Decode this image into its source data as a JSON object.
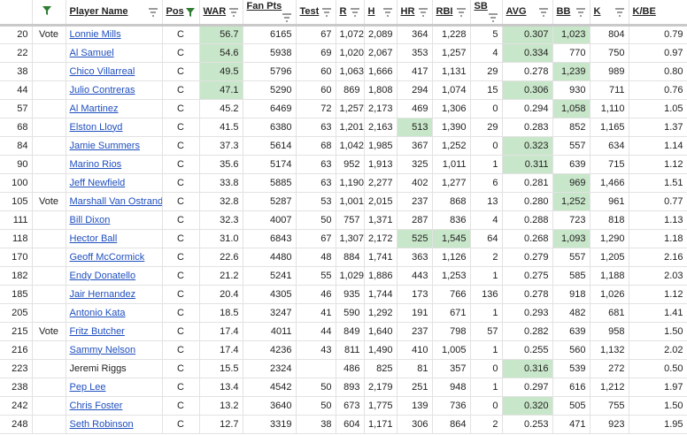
{
  "colors": {
    "highlight": "#c8e6c9",
    "link": "#1f4fbf",
    "filter_active": "#2e7d32",
    "filter_idle": "#7a7a7a"
  },
  "headers": {
    "blank1": "",
    "blank2": "",
    "player": "Player Name",
    "pos": "Pos",
    "war": "WAR",
    "fan": "Fan Pts",
    "test": "Test",
    "r": "R",
    "h": "H",
    "hr": "HR",
    "rbi": "RBI",
    "sb": "SB",
    "avg": "AVG",
    "bb": "BB",
    "k": "K",
    "kbb": "K/BE"
  },
  "rows": [
    {
      "num": "20",
      "vote": "Vote",
      "name": "Lonnie Mills",
      "link": true,
      "pos": "C",
      "war": "56.7",
      "fan": "6165",
      "test": "67",
      "r": "1,072",
      "h": "2,089",
      "hr": "364",
      "rbi": "1,228",
      "sb": "5",
      "avg": "0.307",
      "bb": "1,023",
      "k": "804",
      "kbb": "0.79",
      "hl": [
        "war",
        "avg",
        "bb"
      ]
    },
    {
      "num": "22",
      "vote": "",
      "name": "Al Samuel",
      "link": true,
      "pos": "C",
      "war": "54.6",
      "fan": "5938",
      "test": "69",
      "r": "1,020",
      "h": "2,067",
      "hr": "353",
      "rbi": "1,257",
      "sb": "4",
      "avg": "0.334",
      "bb": "770",
      "k": "750",
      "kbb": "0.97",
      "hl": [
        "war",
        "avg"
      ]
    },
    {
      "num": "38",
      "vote": "",
      "name": "Chico Villarreal",
      "link": true,
      "pos": "C",
      "war": "49.5",
      "fan": "5796",
      "test": "60",
      "r": "1,063",
      "h": "1,666",
      "hr": "417",
      "rbi": "1,131",
      "sb": "29",
      "avg": "0.278",
      "bb": "1,239",
      "k": "989",
      "kbb": "0.80",
      "hl": [
        "war",
        "bb"
      ]
    },
    {
      "num": "44",
      "vote": "",
      "name": "Julio Contreras",
      "link": true,
      "pos": "C",
      "war": "47.1",
      "fan": "5290",
      "test": "60",
      "r": "869",
      "h": "1,808",
      "hr": "294",
      "rbi": "1,074",
      "sb": "15",
      "avg": "0.306",
      "bb": "930",
      "k": "711",
      "kbb": "0.76",
      "hl": [
        "war",
        "avg"
      ]
    },
    {
      "num": "57",
      "vote": "",
      "name": "Al Martinez",
      "link": true,
      "pos": "C",
      "war": "45.2",
      "fan": "6469",
      "test": "72",
      "r": "1,257",
      "h": "2,173",
      "hr": "469",
      "rbi": "1,306",
      "sb": "0",
      "avg": "0.294",
      "bb": "1,058",
      "k": "1,110",
      "kbb": "1.05",
      "hl": [
        "bb"
      ]
    },
    {
      "num": "68",
      "vote": "",
      "name": "Elston Lloyd",
      "link": true,
      "pos": "C",
      "war": "41.5",
      "fan": "6380",
      "test": "63",
      "r": "1,201",
      "h": "2,163",
      "hr": "513",
      "rbi": "1,390",
      "sb": "29",
      "avg": "0.283",
      "bb": "852",
      "k": "1,165",
      "kbb": "1.37",
      "hl": [
        "hr"
      ]
    },
    {
      "num": "84",
      "vote": "",
      "name": "Jamie Summers",
      "link": true,
      "pos": "C",
      "war": "37.3",
      "fan": "5614",
      "test": "68",
      "r": "1,042",
      "h": "1,985",
      "hr": "367",
      "rbi": "1,252",
      "sb": "0",
      "avg": "0.323",
      "bb": "557",
      "k": "634",
      "kbb": "1.14",
      "hl": [
        "avg"
      ]
    },
    {
      "num": "90",
      "vote": "",
      "name": "Marino Rios",
      "link": true,
      "pos": "C",
      "war": "35.6",
      "fan": "5174",
      "test": "63",
      "r": "952",
      "h": "1,913",
      "hr": "325",
      "rbi": "1,011",
      "sb": "1",
      "avg": "0.311",
      "bb": "639",
      "k": "715",
      "kbb": "1.12",
      "hl": [
        "avg"
      ]
    },
    {
      "num": "100",
      "vote": "",
      "name": "Jeff Newfield",
      "link": true,
      "pos": "C",
      "war": "33.8",
      "fan": "5885",
      "test": "63",
      "r": "1,190",
      "h": "2,277",
      "hr": "402",
      "rbi": "1,277",
      "sb": "6",
      "avg": "0.281",
      "bb": "969",
      "k": "1,466",
      "kbb": "1.51",
      "hl": [
        "bb"
      ]
    },
    {
      "num": "105",
      "vote": "Vote",
      "name": "Marshall Van Ostrand",
      "link": true,
      "pos": "C",
      "war": "32.8",
      "fan": "5287",
      "test": "53",
      "r": "1,001",
      "h": "2,015",
      "hr": "237",
      "rbi": "868",
      "sb": "13",
      "avg": "0.280",
      "bb": "1,252",
      "k": "961",
      "kbb": "0.77",
      "hl": [
        "bb"
      ]
    },
    {
      "num": "111",
      "vote": "",
      "name": "Bill Dixon",
      "link": true,
      "pos": "C",
      "war": "32.3",
      "fan": "4007",
      "test": "50",
      "r": "757",
      "h": "1,371",
      "hr": "287",
      "rbi": "836",
      "sb": "4",
      "avg": "0.288",
      "bb": "723",
      "k": "818",
      "kbb": "1.13",
      "hl": []
    },
    {
      "num": "118",
      "vote": "",
      "name": "Hector Ball",
      "link": true,
      "pos": "C",
      "war": "31.0",
      "fan": "6843",
      "test": "67",
      "r": "1,307",
      "h": "2,172",
      "hr": "525",
      "rbi": "1,545",
      "sb": "64",
      "avg": "0.268",
      "bb": "1,093",
      "k": "1,290",
      "kbb": "1.18",
      "hl": [
        "hr",
        "rbi",
        "bb"
      ]
    },
    {
      "num": "170",
      "vote": "",
      "name": "Geoff McCormick",
      "link": true,
      "pos": "C",
      "war": "22.6",
      "fan": "4480",
      "test": "48",
      "r": "884",
      "h": "1,741",
      "hr": "363",
      "rbi": "1,126",
      "sb": "2",
      "avg": "0.279",
      "bb": "557",
      "k": "1,205",
      "kbb": "2.16",
      "hl": []
    },
    {
      "num": "182",
      "vote": "",
      "name": "Endy Donatello",
      "link": true,
      "pos": "C",
      "war": "21.2",
      "fan": "5241",
      "test": "55",
      "r": "1,029",
      "h": "1,886",
      "hr": "443",
      "rbi": "1,253",
      "sb": "1",
      "avg": "0.275",
      "bb": "585",
      "k": "1,188",
      "kbb": "2.03",
      "hl": []
    },
    {
      "num": "185",
      "vote": "",
      "name": "Jair Hernandez",
      "link": true,
      "pos": "C",
      "war": "20.4",
      "fan": "4305",
      "test": "46",
      "r": "935",
      "h": "1,744",
      "hr": "173",
      "rbi": "766",
      "sb": "136",
      "avg": "0.278",
      "bb": "918",
      "k": "1,026",
      "kbb": "1.12",
      "hl": []
    },
    {
      "num": "205",
      "vote": "",
      "name": "Antonio Kata",
      "link": true,
      "pos": "C",
      "war": "18.5",
      "fan": "3247",
      "test": "41",
      "r": "590",
      "h": "1,292",
      "hr": "191",
      "rbi": "671",
      "sb": "1",
      "avg": "0.293",
      "bb": "482",
      "k": "681",
      "kbb": "1.41",
      "hl": []
    },
    {
      "num": "215",
      "vote": "Vote",
      "name": "Fritz Butcher",
      "link": true,
      "pos": "C",
      "war": "17.4",
      "fan": "4011",
      "test": "44",
      "r": "849",
      "h": "1,640",
      "hr": "237",
      "rbi": "798",
      "sb": "57",
      "avg": "0.282",
      "bb": "639",
      "k": "958",
      "kbb": "1.50",
      "hl": []
    },
    {
      "num": "216",
      "vote": "",
      "name": "Sammy Nelson",
      "link": true,
      "pos": "C",
      "war": "17.4",
      "fan": "4236",
      "test": "43",
      "r": "811",
      "h": "1,490",
      "hr": "410",
      "rbi": "1,005",
      "sb": "1",
      "avg": "0.255",
      "bb": "560",
      "k": "1,132",
      "kbb": "2.02",
      "hl": []
    },
    {
      "num": "223",
      "vote": "",
      "name": "Jeremi Riggs",
      "link": false,
      "pos": "C",
      "war": "15.5",
      "fan": "2324",
      "test": "",
      "r": "486",
      "h": "825",
      "hr": "81",
      "rbi": "357",
      "sb": "0",
      "avg": "0.316",
      "bb": "539",
      "k": "272",
      "kbb": "0.50",
      "hl": [
        "avg"
      ]
    },
    {
      "num": "238",
      "vote": "",
      "name": "Pep Lee",
      "link": true,
      "pos": "C",
      "war": "13.4",
      "fan": "4542",
      "test": "50",
      "r": "893",
      "h": "2,179",
      "hr": "251",
      "rbi": "948",
      "sb": "1",
      "avg": "0.297",
      "bb": "616",
      "k": "1,212",
      "kbb": "1.97",
      "hl": []
    },
    {
      "num": "242",
      "vote": "",
      "name": "Chris Foster",
      "link": true,
      "pos": "C",
      "war": "13.2",
      "fan": "3640",
      "test": "50",
      "r": "673",
      "h": "1,775",
      "hr": "139",
      "rbi": "736",
      "sb": "0",
      "avg": "0.320",
      "bb": "505",
      "k": "755",
      "kbb": "1.50",
      "hl": [
        "avg"
      ]
    },
    {
      "num": "248",
      "vote": "",
      "name": "Seth Robinson",
      "link": true,
      "pos": "C",
      "war": "12.7",
      "fan": "3319",
      "test": "38",
      "r": "604",
      "h": "1,171",
      "hr": "306",
      "rbi": "864",
      "sb": "2",
      "avg": "0.253",
      "bb": "471",
      "k": "923",
      "kbb": "1.95",
      "hl": []
    }
  ]
}
